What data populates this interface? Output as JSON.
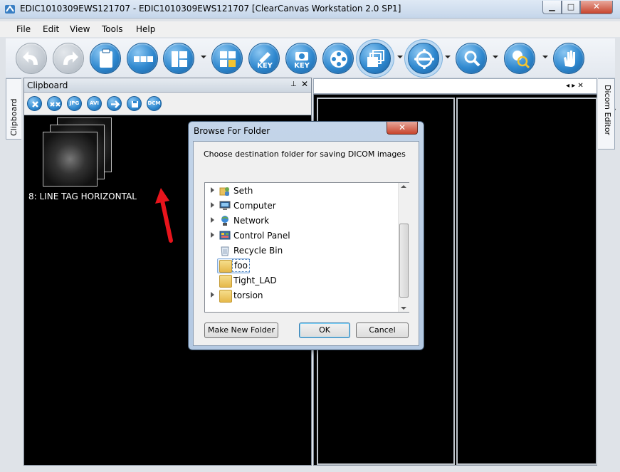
{
  "window": {
    "title": "EDIC1010309EWS121707 - EDIC1010309EWS121707 [ClearCanvas Workstation 2.0 SP1]",
    "min_glyph": "▁",
    "max_glyph": "□",
    "close_glyph": "✕"
  },
  "menu": [
    "File",
    "Edit",
    "View",
    "Tools",
    "Help"
  ],
  "toolbar": {
    "key_label_1": "KEY",
    "key_label_2": "KEY",
    "overflow_glyph": "▾"
  },
  "side_tabs": {
    "left": "Clipboard",
    "right": "Dicom Editor"
  },
  "clipboard": {
    "title": "Clipboard",
    "pin_glyph": "⊥",
    "close_glyph": "✕",
    "buttons": {
      "jpg": "JPG",
      "avi": "AVI",
      "dcm": "DCM"
    },
    "item_label": "8: LINE TAG HORIZONTAL"
  },
  "viewer": {
    "nav": "◂ ▸ ✕"
  },
  "dialog": {
    "title": "Browse For Folder",
    "close_glyph": "✕",
    "prompt": "Choose destination folder for saving DICOM images",
    "tree": [
      {
        "label": "Seth",
        "icon": "user-folder-icon",
        "expandable": true
      },
      {
        "label": "Computer",
        "icon": "computer-icon",
        "expandable": true
      },
      {
        "label": "Network",
        "icon": "network-icon",
        "expandable": true
      },
      {
        "label": "Control Panel",
        "icon": "control-panel-icon",
        "expandable": true
      },
      {
        "label": "Recycle Bin",
        "icon": "recycle-bin-icon",
        "expandable": false
      },
      {
        "label": "foo",
        "icon": "folder-icon",
        "expandable": false,
        "selected": true
      },
      {
        "label": "Tight_LAD",
        "icon": "folder-icon",
        "expandable": false
      },
      {
        "label": "torsion",
        "icon": "folder-icon",
        "expandable": true
      }
    ],
    "buttons": {
      "make_new_folder": "Make New Folder",
      "ok": "OK",
      "cancel": "Cancel"
    }
  },
  "colors": {
    "accent": "#2f88cf",
    "annotation_arrow": "#e8141c"
  }
}
